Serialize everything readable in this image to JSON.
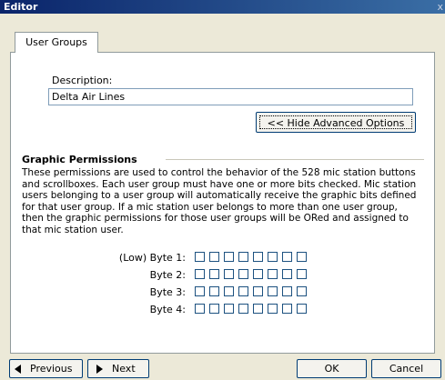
{
  "window": {
    "title": "Editor",
    "close_glyph": "x"
  },
  "tabs": [
    {
      "label": "User Groups"
    }
  ],
  "description": {
    "label": "Description:",
    "value": "Delta Air Lines"
  },
  "advanced_button": {
    "label": "<< Hide Advanced Options"
  },
  "graphic_permissions": {
    "title": "Graphic Permissions",
    "text": "These permissions are used to control the behavior of the 528 mic station buttons and scrollboxes. Each user group must have one or more bits checked. Mic station users belonging to a user group will automatically receive the graphic bits defined for that user group. If a mic station user belongs to more than one user group, then the graphic permissions for those user groups will be ORed and assigned to that mic station user.",
    "bytes": [
      {
        "label": "(Low) Byte 1:",
        "bits": [
          false,
          false,
          false,
          false,
          false,
          false,
          false,
          false
        ]
      },
      {
        "label": "Byte 2:",
        "bits": [
          false,
          false,
          false,
          false,
          false,
          false,
          false,
          false
        ]
      },
      {
        "label": "Byte 3:",
        "bits": [
          false,
          false,
          false,
          false,
          false,
          false,
          false,
          false
        ]
      },
      {
        "label": "Byte 4:",
        "bits": [
          false,
          false,
          false,
          false,
          false,
          false,
          false,
          false
        ]
      }
    ]
  },
  "footer": {
    "previous_label": "Previous",
    "next_label": "Next",
    "ok_label": "OK",
    "cancel_label": "Cancel"
  }
}
